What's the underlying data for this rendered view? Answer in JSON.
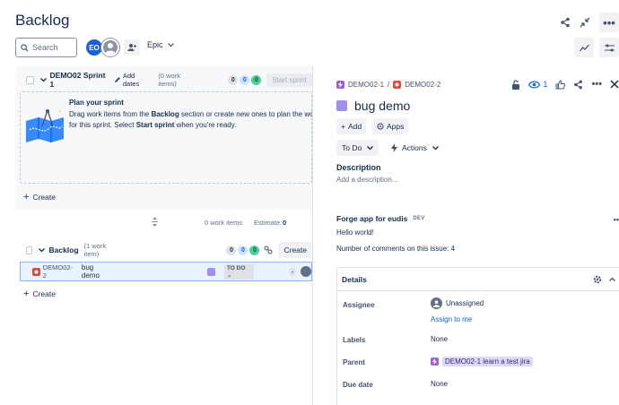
{
  "header": {
    "title": "Backlog"
  },
  "toolbar": {
    "search_placeholder": "Search",
    "avatar_initials": "EO",
    "epic_label": "Epic"
  },
  "sprint": {
    "name": "DEMO02 Sprint 1",
    "add_dates": "Add dates",
    "count": "(0 work items)",
    "counts": [
      "0",
      "0",
      "0"
    ],
    "start_label": "Start sprint",
    "plan_title": "Plan your sprint",
    "plan_text_1": "Drag work items from the ",
    "plan_bold_1": "Backlog",
    "plan_text_2": " section or create new ones to plan the work for this sprint. Select ",
    "plan_bold_2": "Start sprint",
    "plan_text_3": " when you're ready.",
    "create_label": "Create",
    "work_items_stat": "0 work items",
    "estimate_label": "Estimate:",
    "estimate_value": "0"
  },
  "backlog": {
    "name": "Backlog",
    "count": "(1 work item)",
    "counts": [
      "0",
      "0",
      "0"
    ],
    "create_label": "Create",
    "create_link": "Create",
    "issues": [
      {
        "key": "DEMO02-2",
        "summary": "bug demo",
        "status": "TO DO",
        "estimate": "-"
      }
    ]
  },
  "detail": {
    "parent_key": "DEMO02-1",
    "issue_key": "DEMO02-2",
    "watchers": "1",
    "title": "bug demo",
    "add_label": "Add",
    "apps_label": "Apps",
    "status": "To Do",
    "actions_label": "Actions",
    "description_heading": "Description",
    "description_placeholder": "Add a description...",
    "forge_title": "Forge app for eudis",
    "forge_badge": "DEV",
    "forge_hello": "Hello world!",
    "forge_comments": "Number of comments on this issue: 4",
    "details_heading": "Details",
    "fields": {
      "assignee_label": "Assignee",
      "assignee_value": "Unassigned",
      "assign_to_me": "Assign to me",
      "labels_label": "Labels",
      "labels_value": "None",
      "parent_label": "Parent",
      "parent_value": "DEMO02-1 learn a test jira",
      "due_label": "Due date",
      "due_value": "None"
    }
  },
  "colors": {
    "accent": "#0c66e4",
    "bug": "#e2483d",
    "epic": "#9f5fd9",
    "task_purple": "#9f8fef",
    "selected_row": "#e9f2ff"
  }
}
